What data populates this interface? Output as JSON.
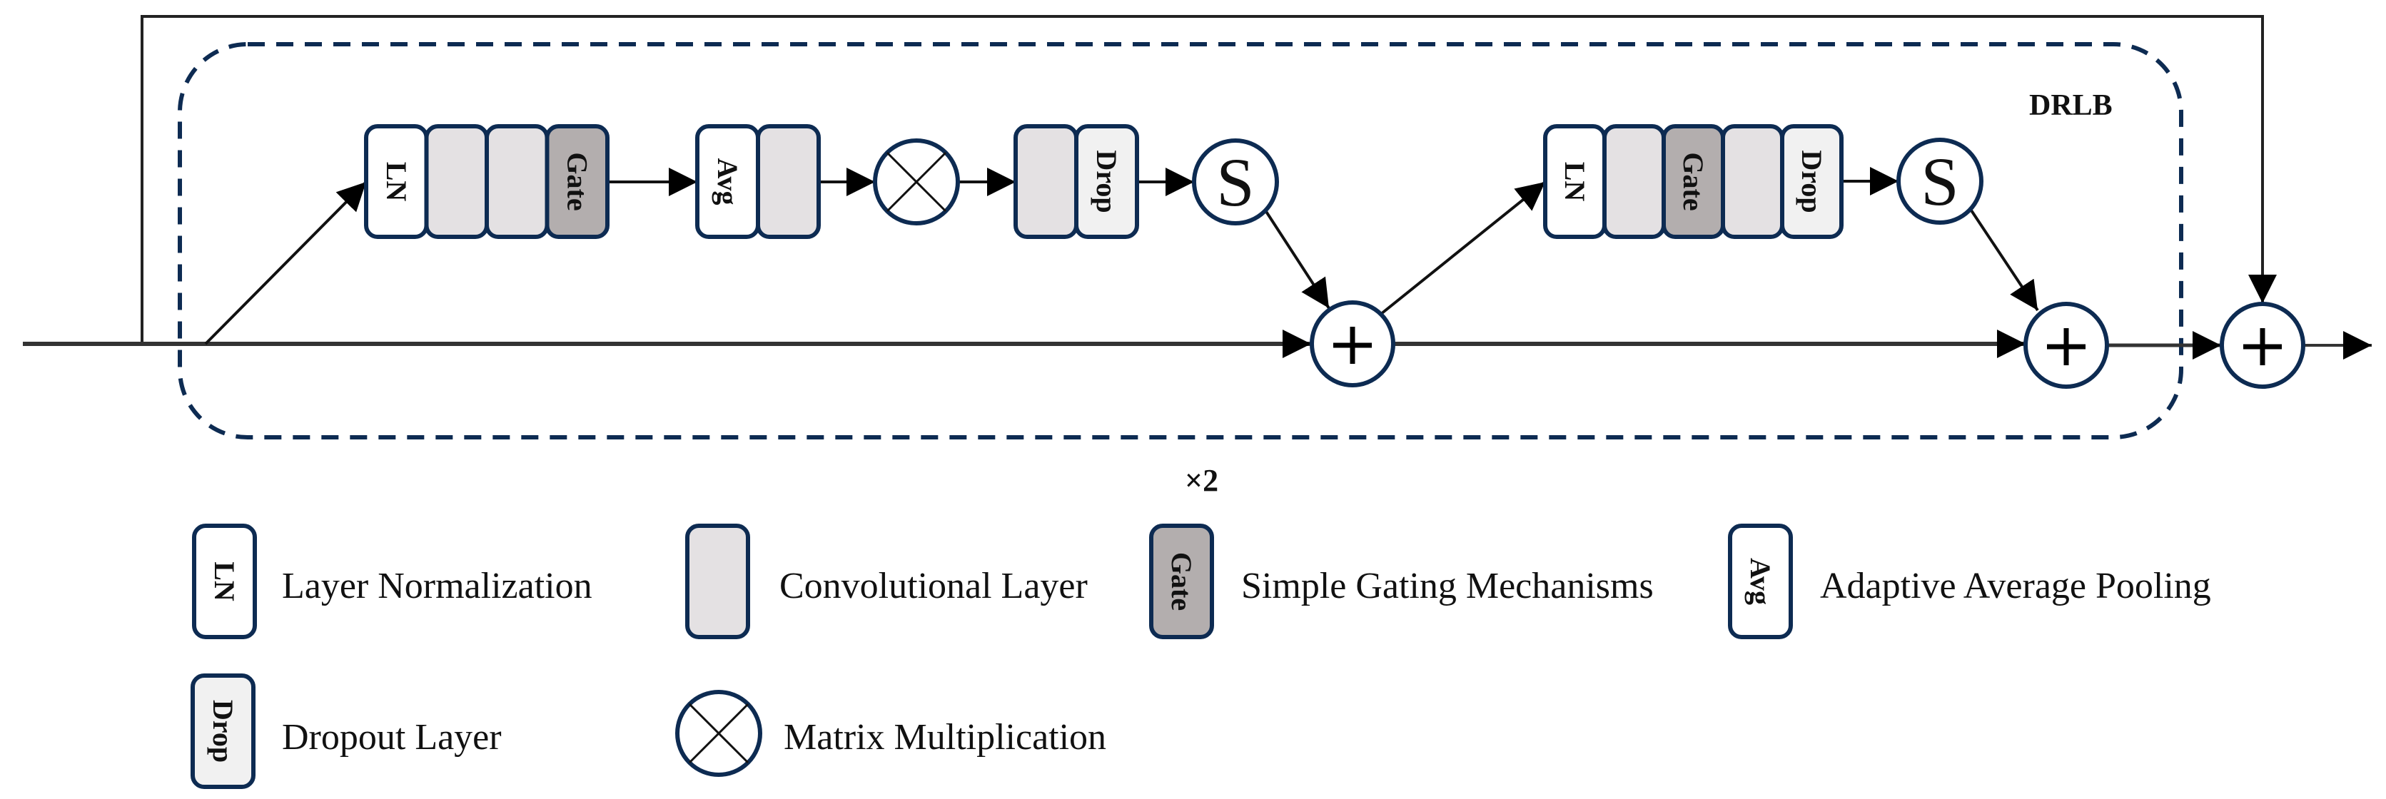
{
  "figure": {
    "block_label": "DRLB",
    "repeat_label": "×2"
  },
  "colors": {
    "border": "#0d2b52",
    "dashed_border": "#0d2b52",
    "ln_fill": "#ffffff",
    "conv_fill": "#e4e1e3",
    "gate_fill": "#b3aeae",
    "avg_fill": "#ffffff",
    "drop_fill": "#f1f1f1",
    "line": "#222222"
  },
  "branch1": {
    "group_a": [
      "LN",
      "",
      "",
      "Gate"
    ],
    "group_b": [
      "Avg",
      ""
    ],
    "op_matrix": "matrix-multiplication",
    "group_c": [
      "",
      "Drop"
    ],
    "op_scale": "S"
  },
  "branch2": {
    "group_a": [
      "LN",
      "",
      "Gate",
      "",
      "Drop"
    ],
    "op_scale": "S"
  },
  "adders": [
    "+",
    "+",
    "+"
  ],
  "legend": {
    "items": [
      {
        "key": "ln",
        "glyph": "LN",
        "label": "Layer Normalization"
      },
      {
        "key": "conv",
        "glyph": "",
        "label": "Convolutional Layer"
      },
      {
        "key": "gate",
        "glyph": "Gate",
        "label": "Simple Gating Mechanisms"
      },
      {
        "key": "avg",
        "glyph": "Avg",
        "label": "Adaptive Average Pooling"
      },
      {
        "key": "drop",
        "glyph": "Drop",
        "label": "Dropout Layer"
      },
      {
        "key": "matmul",
        "glyph": "",
        "label": "Matrix Multiplication"
      }
    ]
  }
}
